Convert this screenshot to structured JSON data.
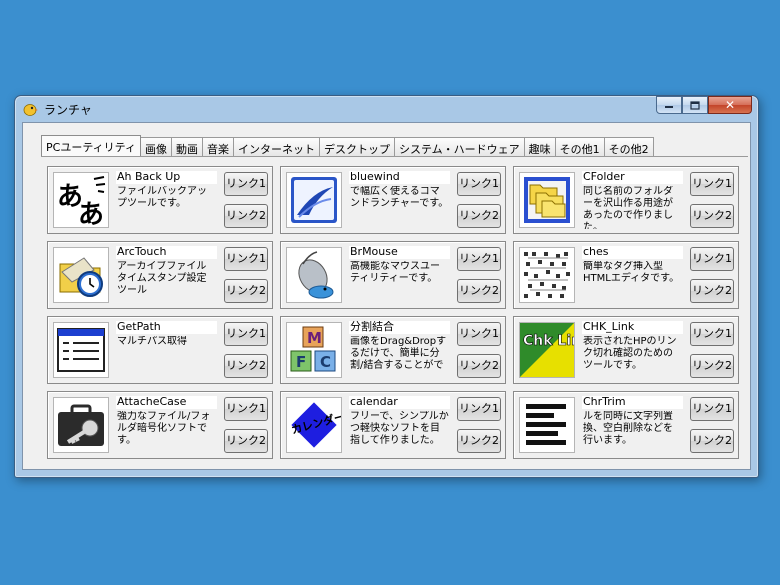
{
  "window": {
    "title": "ランチャ",
    "close_glyph": "✕"
  },
  "tabs": [
    {
      "label": "PCユーティリティ",
      "active": true
    },
    {
      "label": "画像"
    },
    {
      "label": "動画"
    },
    {
      "label": "音楽"
    },
    {
      "label": "インターネット"
    },
    {
      "label": "デスクトップ"
    },
    {
      "label": "システム・ハードウェア"
    },
    {
      "label": "趣味"
    },
    {
      "label": "その他1"
    },
    {
      "label": "その他2"
    }
  ],
  "link_labels": {
    "link1": "リンク1",
    "link2": "リンク2"
  },
  "apps": [
    {
      "name": "Ah Back Up",
      "desc": "ファイルバックアップツールです。",
      "icon": "ah-backup-icon",
      "icon_text": "あ"
    },
    {
      "name": "bluewind",
      "desc": "で幅広く使えるコマンドランチャーです。",
      "icon": "bluewind-icon"
    },
    {
      "name": "CFolder",
      "desc": "同じ名前のフォルダーを沢山作る用途があったので作りました。",
      "icon": "cfolder-icon"
    },
    {
      "name": "ArcTouch",
      "desc": "アーカイブファイル タイムスタンプ設定ツール",
      "icon": "arctouch-icon"
    },
    {
      "name": "BrMouse",
      "desc": "高機能なマウスユーティリティーです。",
      "icon": "brmouse-icon"
    },
    {
      "name": "ches",
      "desc": "簡単なタグ挿入型HTMLエディタです。",
      "icon": "ches-icon"
    },
    {
      "name": "GetPath",
      "desc": "マルチパス取得",
      "icon": "getpath-icon"
    },
    {
      "name": "分割結合",
      "desc": "画像をDrag&Dropするだけで、簡単に分割/結合することがで",
      "icon": "bunkatsu-icon",
      "icon_letters": [
        "M",
        "F",
        "C"
      ]
    },
    {
      "name": "CHK_Link",
      "desc": "表示されたHPのリンク切れ確認のためのツールです。",
      "icon": "chklink-icon",
      "icon_text": "Chk Link"
    },
    {
      "name": "AttacheCase",
      "desc": "強力なファイル/フォルダ暗号化ソフトです。",
      "icon": "attachecase-icon"
    },
    {
      "name": "calendar",
      "desc": "フリーで、シンプルかつ軽快なソフトを目指して作りました。",
      "icon": "calendar-icon",
      "icon_text": "カレンダー"
    },
    {
      "name": "ChrTrim",
      "desc": "ルを同時に文字列置換、空白削除などを行います。",
      "icon": "chrtrim-icon"
    }
  ]
}
